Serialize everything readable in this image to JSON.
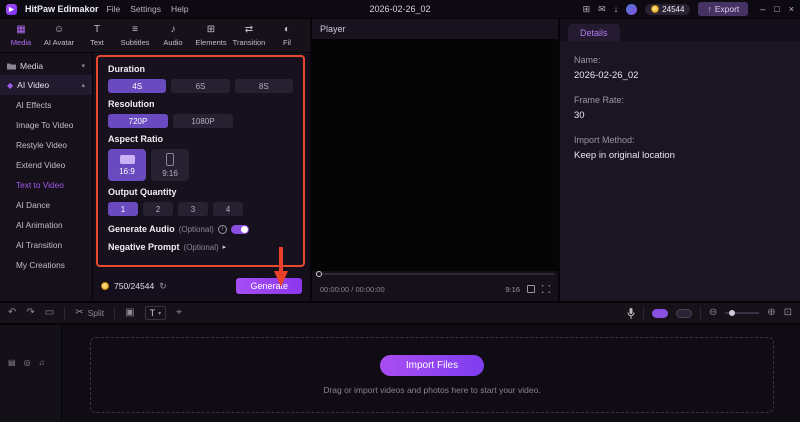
{
  "colors": {
    "accent": "#9b5cf6",
    "highlight_border": "#e64a2e",
    "selected_option": "#6a4bbf"
  },
  "titlebar": {
    "app_name": "HitPaw Edimakor",
    "menus": [
      "File",
      "Settings",
      "Help"
    ],
    "document_title": "2026-02-26_02",
    "coin_count": "24544",
    "export_label": "Export"
  },
  "icons": {
    "grid": "⊞",
    "mail": "✉",
    "download": "↓",
    "minimize": "–",
    "maximize": "□",
    "close": "×",
    "export_arrow": "↑",
    "chevron_down": "▾",
    "chevron_up": "▴",
    "chevron_right": "▸",
    "gem": "◆",
    "undo": "↶",
    "redo": "↷",
    "trash": "▭",
    "scissors": "✂",
    "crop": "▣",
    "marker": "⌖",
    "refresh": "↻",
    "info": "i",
    "zoom_out": "⊖",
    "zoom_in": "⊕",
    "fit": "⊡",
    "track_options": "▤",
    "track_visibility": "◎",
    "track_volume": "♫"
  },
  "tabs": [
    {
      "label": "Media",
      "icon": "▦"
    },
    {
      "label": "AI Avatar",
      "icon": "☺"
    },
    {
      "label": "Text",
      "icon": "T"
    },
    {
      "label": "Subtitles",
      "icon": "≡"
    },
    {
      "label": "Audio",
      "icon": "♪"
    },
    {
      "label": "Elements",
      "icon": "⊞"
    },
    {
      "label": "Transition",
      "icon": "⇄"
    },
    {
      "label": "Fil",
      "icon": "◐"
    }
  ],
  "sidebar": {
    "media_label": "Media",
    "ai_video_label": "AI Video",
    "items": [
      "AI Effects",
      "Image To Video",
      "Restyle Video",
      "Extend Video",
      "Text to Video",
      "AI Dance",
      "AI Animation",
      "AI Transition",
      "My Creations"
    ],
    "active_item": "Text to Video"
  },
  "settings": {
    "duration": {
      "label": "Duration",
      "options": [
        "4S",
        "6S",
        "8S"
      ],
      "selected": "4S"
    },
    "resolution": {
      "label": "Resolution",
      "options": [
        "720P",
        "1080P"
      ],
      "selected": "720P"
    },
    "aspect_ratio": {
      "label": "Aspect Ratio",
      "options": [
        "16:9",
        "9:16"
      ],
      "selected": "16:9"
    },
    "output_quantity": {
      "label": "Output Quantity",
      "options": [
        "1",
        "2",
        "3",
        "4"
      ],
      "selected": "1"
    },
    "generate_audio": {
      "label": "Generate Audio",
      "optional": "(Optional)",
      "enabled": true
    },
    "negative_prompt": {
      "label": "Negative Prompt",
      "optional": "(Optional)"
    },
    "credits": "750/24544",
    "generate_label": "Generate"
  },
  "player": {
    "title": "Player",
    "timecode": "00:00:00 / 00:00:00",
    "aspect": "9:16"
  },
  "details": {
    "tab": "Details",
    "fields": [
      {
        "label": "Name:",
        "value": "2026-02-26_02"
      },
      {
        "label": "Frame Rate:",
        "value": "30"
      },
      {
        "label": "Import Method:",
        "value": "Keep in original location"
      }
    ]
  },
  "toolbar": {
    "split_label": "Split",
    "text_tool": "T"
  },
  "timeline": {
    "import_button": "Import Files",
    "hint": "Drag or import videos and photos here to start your video."
  }
}
